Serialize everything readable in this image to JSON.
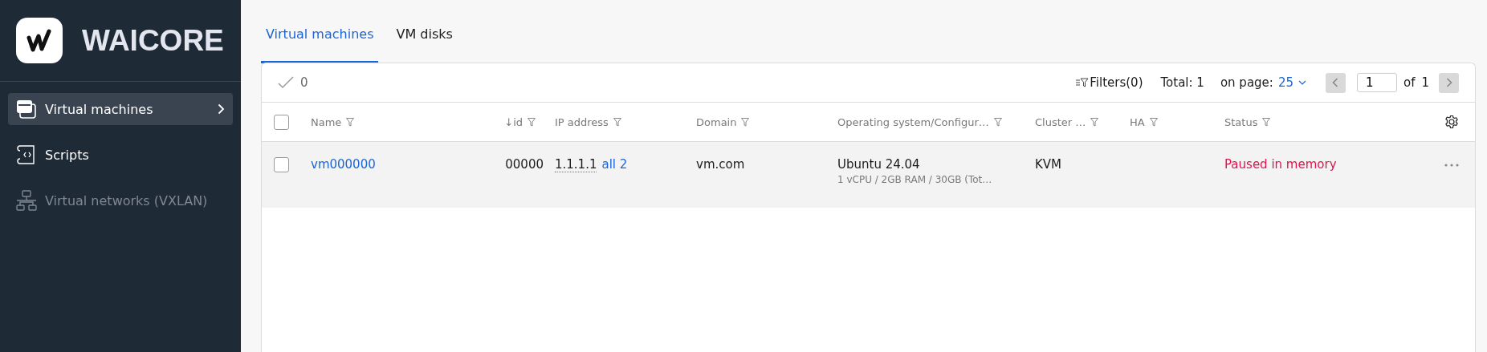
{
  "sidebar": {
    "brand": "WAICORE",
    "items": [
      {
        "label": "Virtual machines",
        "selected": true,
        "disabled": false
      },
      {
        "label": "Scripts",
        "selected": false,
        "disabled": false
      },
      {
        "label": "Virtual networks (VXLAN)",
        "selected": false,
        "disabled": true
      }
    ]
  },
  "tabs": [
    {
      "label": "Virtual machines",
      "selected": true
    },
    {
      "label": "VM disks",
      "selected": false
    }
  ],
  "toolbar": {
    "selected_count": "0",
    "filters": "Filters(0)",
    "total": "Total: 1",
    "on_page_label": "on page:",
    "on_page_value": "25",
    "page": "1",
    "of_label": "of",
    "page_count": "1"
  },
  "table": {
    "header_checked": false,
    "columns": [
      {
        "label": "Name"
      },
      {
        "label": "↓id"
      },
      {
        "label": "IP address"
      },
      {
        "label": "Domain"
      },
      {
        "label": "Operating system/Configur…"
      },
      {
        "label": "Cluster …"
      },
      {
        "label": "HA"
      },
      {
        "label": "Status"
      }
    ],
    "rows": [
      {
        "checked": false,
        "name": "vm000000",
        "id": "00000",
        "ip": "1.1.1.1",
        "ip_more": "all 2",
        "domain": "vm.com",
        "os": "Ubuntu 24.04",
        "config": "1 vCPU / 2GB RAM / 30GB (Tot…",
        "cluster": "KVM",
        "status": "Paused in memory"
      }
    ]
  }
}
